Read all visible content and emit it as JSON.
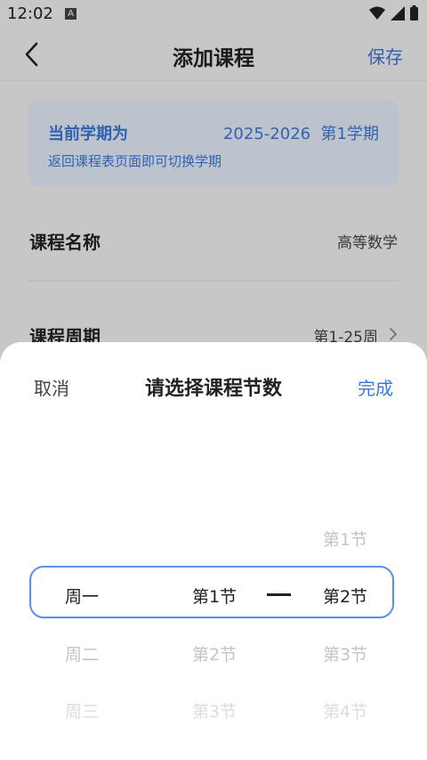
{
  "status_bar": {
    "time": "12:02",
    "notification_icon": "A"
  },
  "header": {
    "title": "添加课程",
    "save_label": "保存",
    "back_icon": "chevron-left-icon"
  },
  "term_card": {
    "label": "当前学期为",
    "value": "2025-2026  第1学期",
    "hint": "返回课程表页面即可切换学期"
  },
  "form": {
    "course_name_label": "课程名称",
    "course_name_value": "高等数学",
    "course_weeks_label": "课程周期",
    "course_weeks_value": "第1-25周"
  },
  "sheet": {
    "cancel_label": "取消",
    "title": "请选择课程节数",
    "done_label": "完成",
    "weekday_options": [
      "周一",
      "周二",
      "周三"
    ],
    "start_options": [
      "第1节",
      "第2节",
      "第3节"
    ],
    "end_options": [
      "第1节",
      "第2节",
      "第3节",
      "第4节"
    ],
    "dash": "—"
  },
  "colors": {
    "accent": "#3c78d8",
    "highlight_border": "#5b8def"
  }
}
